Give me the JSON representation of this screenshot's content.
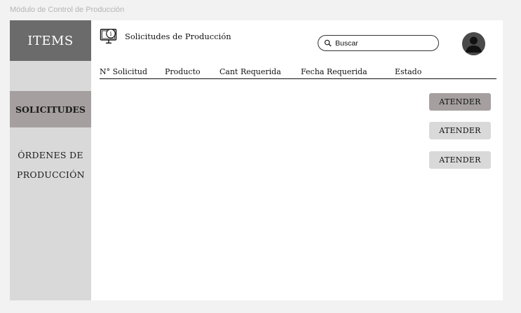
{
  "frame": {
    "title": "Módulo de Control de Producción"
  },
  "sidebar": {
    "brand": "ITEMS",
    "items": [
      {
        "label": "SOLICITUDES",
        "active": true
      },
      {
        "label": "ÓRDENES DE PRODUCCIÓN",
        "active": false
      }
    ]
  },
  "header": {
    "icon": "monitor-info-icon",
    "title": "Solicitudes de Producción",
    "search": {
      "placeholder": "Buscar",
      "value": "",
      "icon": "search-icon"
    },
    "avatar_icon": "user-avatar-icon"
  },
  "table": {
    "columns": [
      "N° Solicitud",
      "Producto",
      "Cant Requerida",
      "Fecha Requerida",
      "Estado"
    ],
    "rows": []
  },
  "actions": [
    {
      "label": "ATENDER",
      "active": true
    },
    {
      "label": "ATENDER",
      "active": false
    },
    {
      "label": "ATENDER",
      "active": false
    }
  ],
  "colors": {
    "brand_bg": "#6b6b6b",
    "sidebar_bg": "#d9d9d9",
    "active_bg": "#a59f9f",
    "button_idle_bg": "#d9d9d9"
  }
}
